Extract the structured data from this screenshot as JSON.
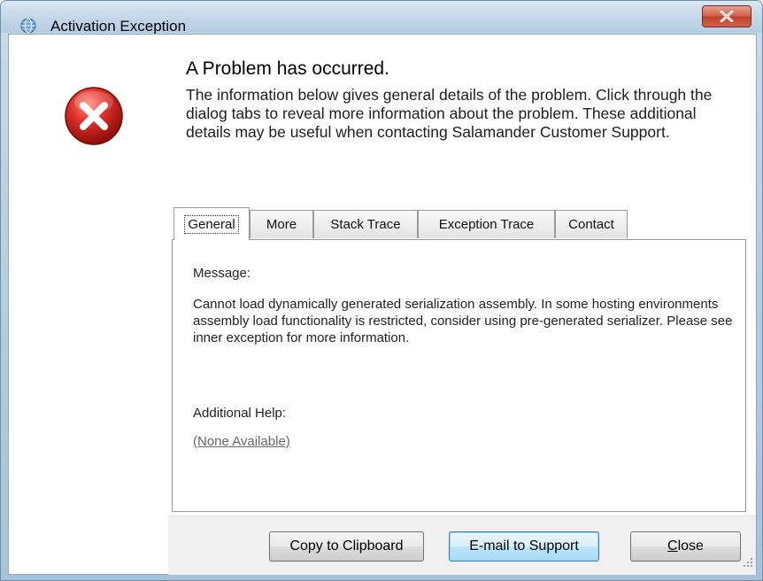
{
  "window": {
    "title": "Activation Exception",
    "icon": "globe-icon",
    "close_icon": "close-x-icon"
  },
  "header": {
    "headline": "A Problem has occurred.",
    "intro": "The information below gives general details of the problem. Click through the dialog tabs to reveal more information about the problem. These additional details may be useful when contacting Salamander Customer Support."
  },
  "tabs": [
    {
      "label": "General",
      "selected": true
    },
    {
      "label": "More",
      "selected": false
    },
    {
      "label": "Stack Trace",
      "selected": false
    },
    {
      "label": "Exception Trace",
      "selected": false
    },
    {
      "label": "Contact",
      "selected": false
    }
  ],
  "general": {
    "message_label": "Message:",
    "message_text": "Cannot load dynamically generated serialization assembly. In some hosting environments assembly load functionality is restricted, consider using pre-generated serializer. Please see inner exception for more information.",
    "help_label": "Additional Help:",
    "help_link": "(None Available)"
  },
  "buttons": {
    "copy": "Copy to Clipboard",
    "email": "E-mail to Support",
    "close_rest": "lose",
    "close_mnemonic": "C"
  },
  "colors": {
    "error_red": "#d62a1e",
    "accent_blue": "#3c7fb1",
    "titlebar": "#c5d8ea"
  }
}
